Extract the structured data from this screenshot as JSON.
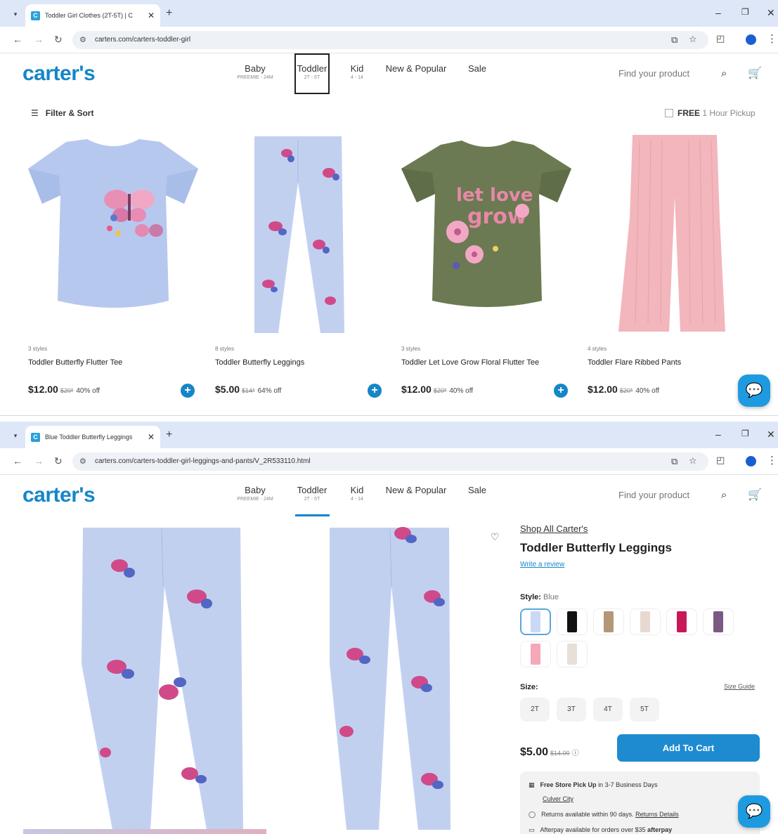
{
  "browser1": {
    "tab_title": "Toddler Girl Clothes (2T-5T) | C",
    "url": "carters.com/carters-toddler-girl"
  },
  "browser2": {
    "tab_title": "Blue Toddler Butterfly Leggings",
    "url": "carters.com/carters-toddler-girl-leggings-and-pants/V_2R533110.html"
  },
  "brand": {
    "logo": "carter's"
  },
  "nav": {
    "items": [
      {
        "label": "Baby",
        "sub": "PREEMIE - 24M"
      },
      {
        "label": "Toddler",
        "sub": "2T - 5T"
      },
      {
        "label": "Kid",
        "sub": "4 - 14"
      },
      {
        "label": "New & Popular",
        "sub": ""
      },
      {
        "label": "Sale",
        "sub": ""
      }
    ],
    "search_placeholder": "Find your product"
  },
  "listing": {
    "filter_label": "Filter & Sort",
    "pickup_free": "FREE",
    "pickup_rest": "1 Hour Pickup",
    "products": [
      {
        "styles": "3 styles",
        "name": "Toddler Butterfly Flutter Tee",
        "price": "$12.00",
        "was": "$20*",
        "off": "40% off"
      },
      {
        "styles": "8 styles",
        "name": "Toddler Butterfly Leggings",
        "price": "$5.00",
        "was": "$14*",
        "off": "64% off"
      },
      {
        "styles": "3 styles",
        "name": "Toddler Let Love Grow Floral Flutter Tee",
        "price": "$12.00",
        "was": "$20*",
        "off": "40% off"
      },
      {
        "styles": "4 styles",
        "name": "Toddler Flare Ribbed Pants",
        "price": "$12.00",
        "was": "$20*",
        "off": "40% off"
      }
    ]
  },
  "product": {
    "shop_all": "Shop All Carter's",
    "title": "Toddler Butterfly Leggings",
    "review_link": "Write a review",
    "style_label": "Style:",
    "style_value": "Blue",
    "swatches": [
      "#c9d8f5",
      "#111111",
      "#b39878",
      "#e8d8d2",
      "#c8185a",
      "#7a5a82",
      "#f4a8b8",
      "#e6e0d8"
    ],
    "size_label": "Size:",
    "size_guide": "Size Guide",
    "sizes": [
      "2T",
      "3T",
      "4T",
      "5T"
    ],
    "price": "$5.00",
    "was": "$14.00",
    "add_to_cart": "Add To Cart",
    "pickup_bold": "Free Store Pick Up",
    "pickup_rest": "in 3-7 Business Days",
    "store": "Culver City",
    "returns_text": "Returns available within 90 days.",
    "returns_link": "Returns Details",
    "afterpay_text": "Afterpay available for orders over $35",
    "afterpay_brand": "afterpay"
  },
  "colors": {
    "brand": "#1586c8",
    "button": "#1e8bd0",
    "tabbar": "#dde7f8"
  }
}
